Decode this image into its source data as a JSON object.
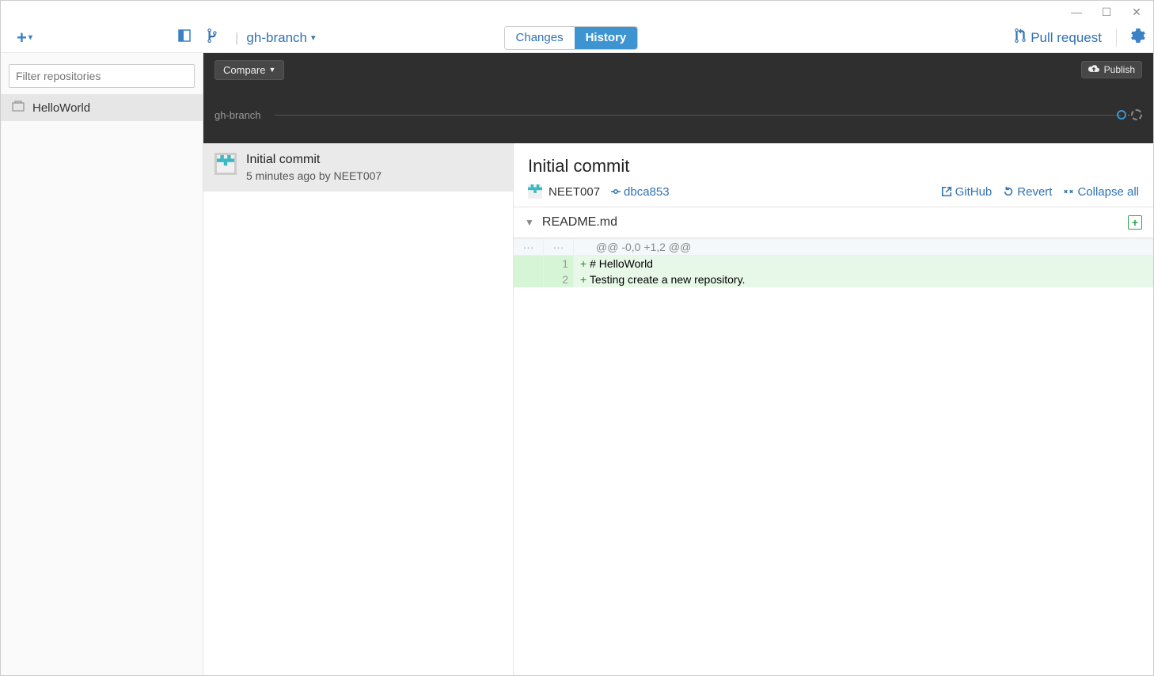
{
  "toolbar": {
    "branch_label": "gh-branch",
    "segments": {
      "changes": "Changes",
      "history": "History"
    },
    "pull_request_label": "Pull request"
  },
  "sidebar": {
    "filter_placeholder": "Filter repositories",
    "repos": [
      {
        "name": "HelloWorld"
      }
    ]
  },
  "compare": {
    "button": "Compare",
    "publish": "Publish"
  },
  "timeline": {
    "label": "gh-branch"
  },
  "commits": [
    {
      "title": "Initial commit",
      "meta": "5 minutes ago by NEET007"
    }
  ],
  "detail": {
    "title": "Initial commit",
    "author": "NEET007",
    "sha": "dbca853",
    "actions": {
      "github": "GitHub",
      "revert": "Revert",
      "collapse": "Collapse all"
    },
    "file": {
      "name": "README.md",
      "hunk": "@@ -0,0 +1,2 @@",
      "lines": [
        {
          "new_ln": "1",
          "text": "# HelloWorld"
        },
        {
          "new_ln": "2",
          "text": "Testing create a new repository."
        }
      ]
    }
  }
}
